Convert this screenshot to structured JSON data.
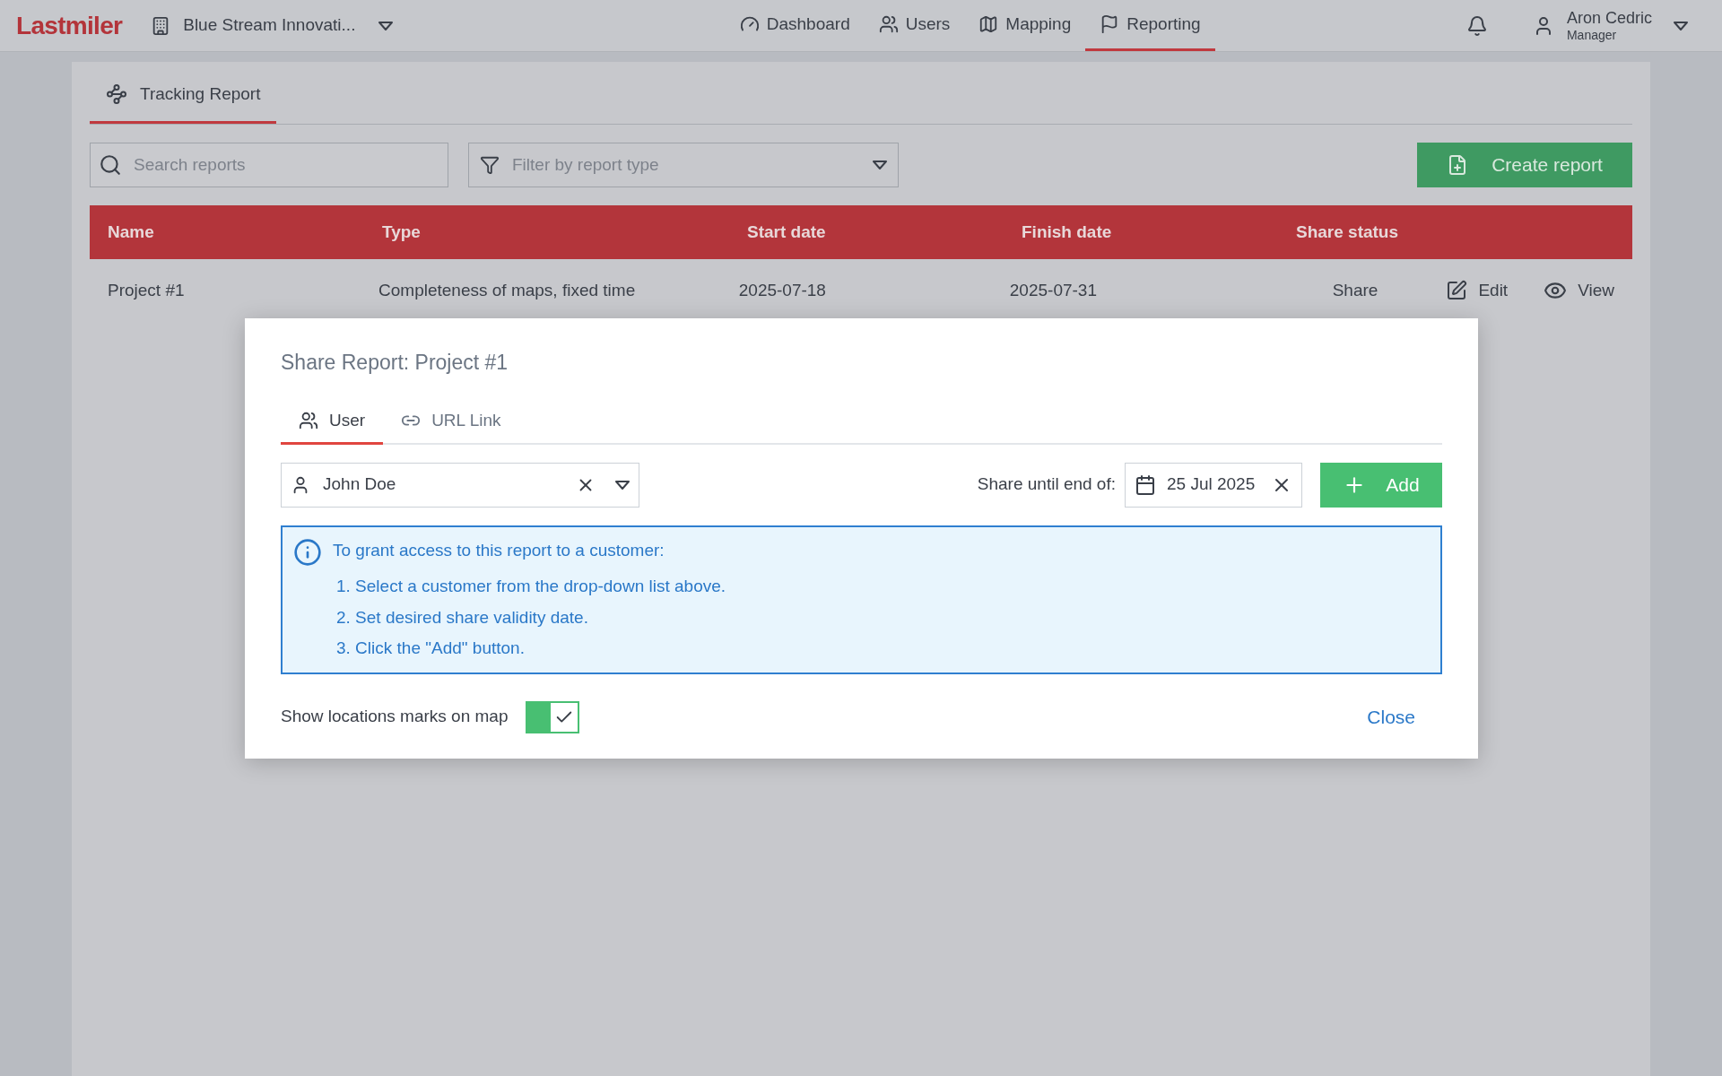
{
  "app": {
    "logo": "Lastmiler"
  },
  "organization": {
    "name": "Blue Stream Innovati..."
  },
  "nav": [
    {
      "label": "Dashboard",
      "kind": "gauge",
      "selected": false
    },
    {
      "label": "Users",
      "kind": "users",
      "selected": false
    },
    {
      "label": "Mapping",
      "kind": "map",
      "selected": false
    },
    {
      "label": "Reporting",
      "kind": "flag",
      "selected": true
    }
  ],
  "user": {
    "name": "Aron Cedric",
    "role": "Manager"
  },
  "page_tabs": [
    {
      "label": "Tracking Report",
      "selected": true
    }
  ],
  "search": {
    "placeholder": "Search reports"
  },
  "filter": {
    "placeholder": "Filter by report type"
  },
  "create_button": "Create report",
  "table": {
    "columns": [
      "Name",
      "Type",
      "Start date",
      "Finish date",
      "Share status"
    ],
    "rows": [
      {
        "cells": [
          "Project #1",
          "Completeness of maps, fixed time",
          "2025-07-18",
          "2025-07-31",
          "Share"
        ],
        "actions": [
          {
            "label": "Edit",
            "kind": "edit"
          },
          {
            "label": "View",
            "kind": "view"
          }
        ]
      }
    ]
  },
  "dialog": {
    "title": "Share Report: Project #1",
    "tabs": [
      {
        "label": "User",
        "kind": "users",
        "selected": true
      },
      {
        "label": "URL Link",
        "kind": "link",
        "selected": false
      }
    ],
    "user_select": {
      "value": "John Doe"
    },
    "share_until": {
      "label": "Share until end of:",
      "value": "25 Jul 2025"
    },
    "add_button": "Add",
    "info": {
      "title": "To grant access to this report to a customer:",
      "steps": [
        "1. Select a customer from the drop-down list above.",
        "2. Set desired share validity date.",
        "3. Click the \"Add\" button."
      ]
    },
    "toggle": {
      "label": "Show locations marks on map",
      "on": true
    },
    "close_button": "Close"
  }
}
